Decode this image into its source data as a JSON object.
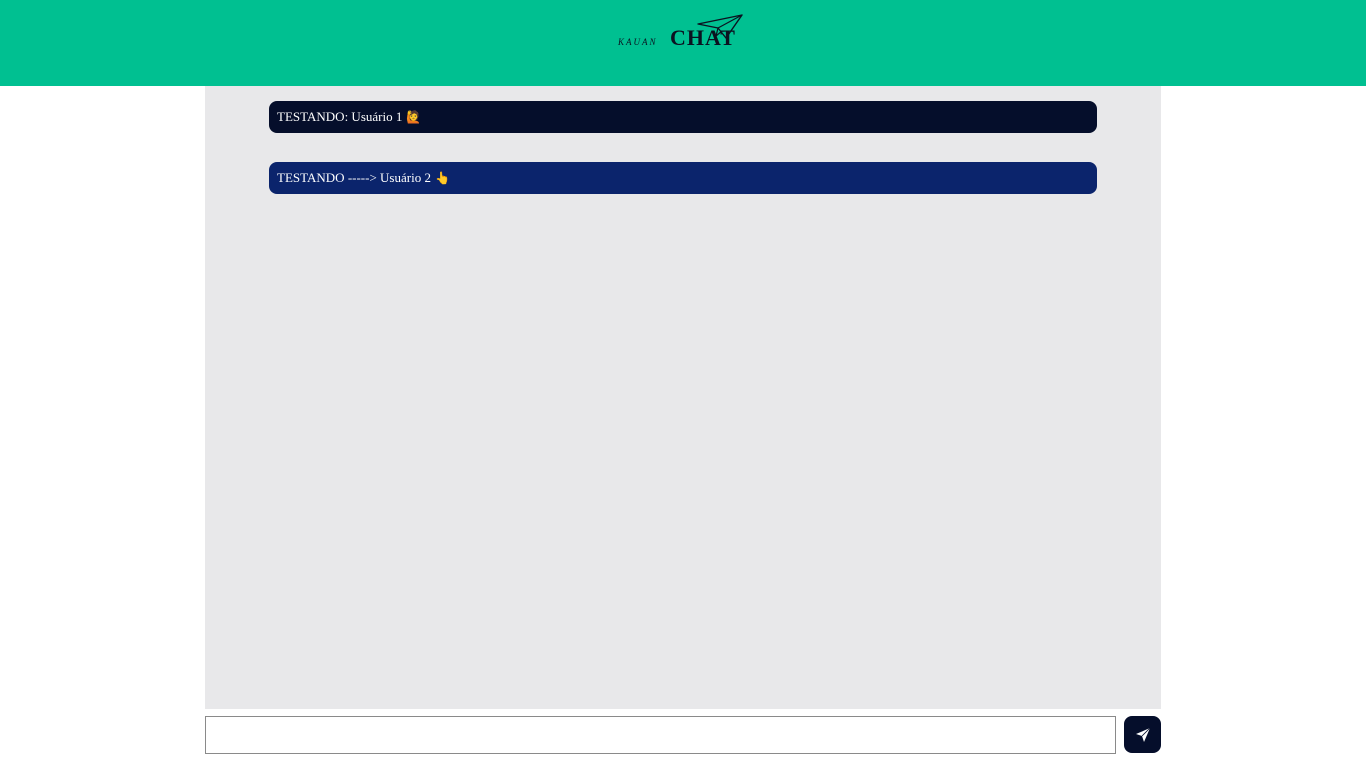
{
  "header": {
    "logo": {
      "small_text": "KAUAN",
      "big_text": "CHAT",
      "icon": "paper-plane-icon"
    },
    "background_color": "#00c091"
  },
  "chat": {
    "background_color": "#e8e8ea",
    "messages": [
      {
        "text": "TESTANDO: Usuário 1",
        "emoji": "🙋",
        "color": "#050e2b"
      },
      {
        "text": "TESTANDO -----> Usuário 2",
        "emoji": "👆",
        "color": "#0b246c"
      }
    ]
  },
  "composer": {
    "input_value": "",
    "input_placeholder": "",
    "send_icon": "send-icon"
  }
}
